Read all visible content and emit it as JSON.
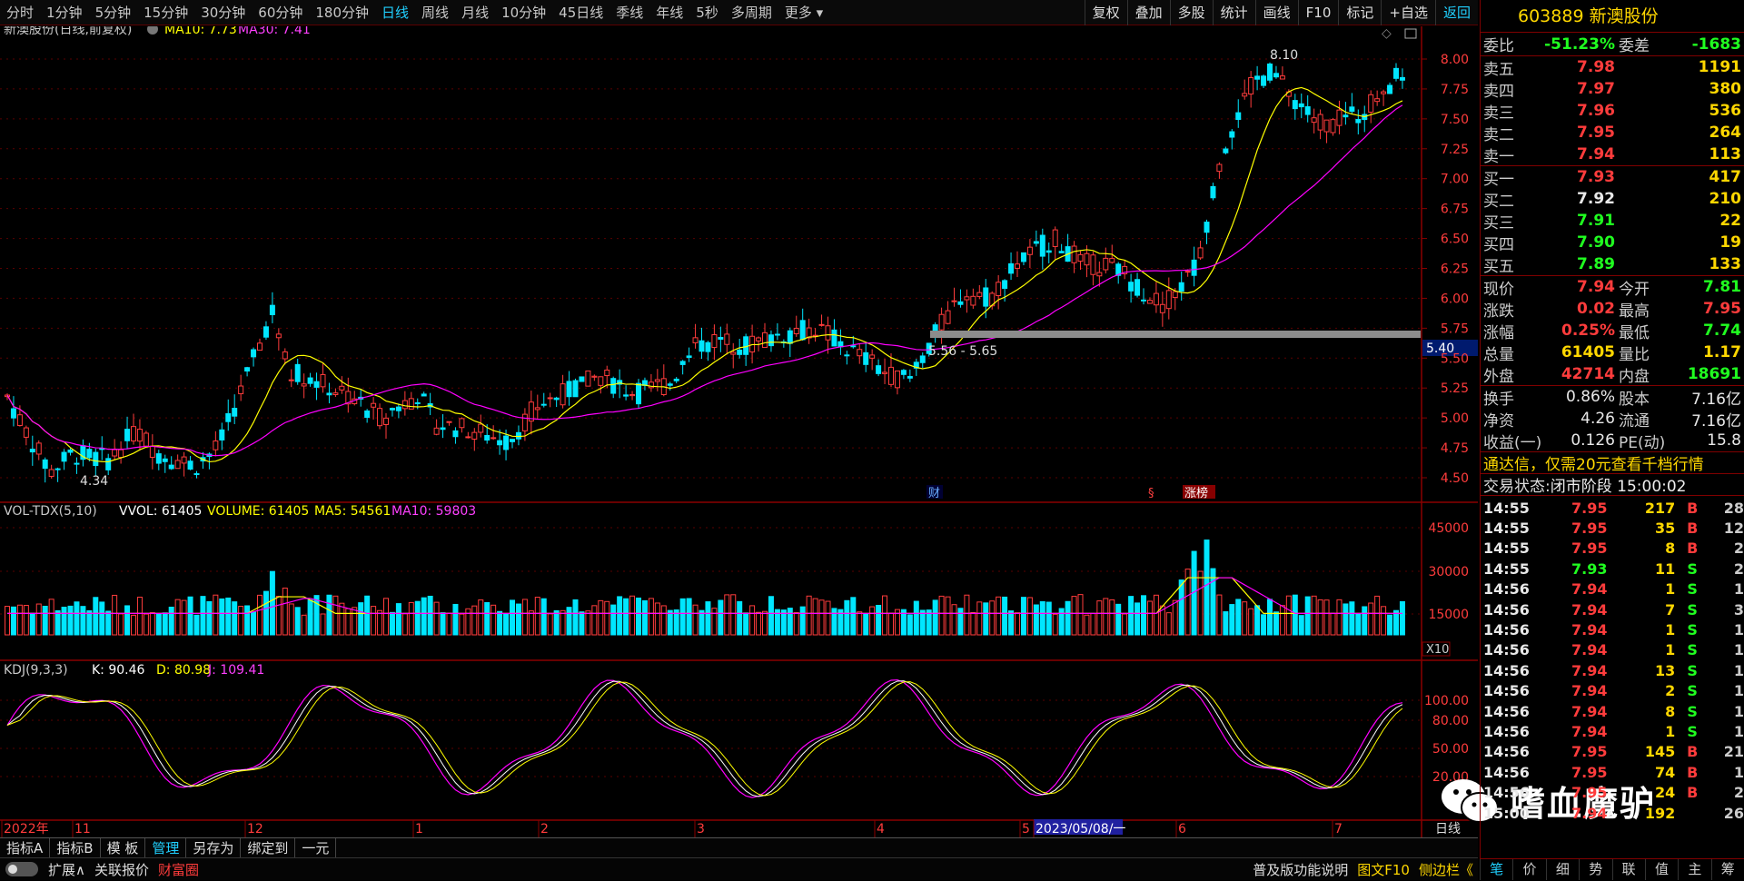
{
  "toolbar": {
    "periods": [
      "分时",
      "1分钟",
      "5分钟",
      "15分钟",
      "30分钟",
      "60分钟",
      "180分钟",
      "日线",
      "周线",
      "月线",
      "10分钟",
      "45日线",
      "季线",
      "年线",
      "5秒",
      "多周期",
      "更多"
    ],
    "active_period": "日线",
    "right_tools": [
      "复权",
      "叠加",
      "多股",
      "统计",
      "画线",
      "F10",
      "标记",
      "+自选",
      "返回"
    ]
  },
  "main_chart": {
    "title": "新澳股份(日线,前复权)",
    "ma10": "MA10: 7.73",
    "ma30": "MA30: 7.41",
    "high_label": "8.10",
    "low_label": "4.34",
    "range_label": "5.56 - 5.65",
    "price_tag": "5.40",
    "markers": [
      "财",
      "§",
      "涨榜"
    ],
    "y_ticks": [
      "8.00",
      "7.75",
      "7.50",
      "7.25",
      "7.00",
      "6.75",
      "6.50",
      "6.25",
      "6.00",
      "5.75",
      "5.50",
      "5.25",
      "5.00",
      "4.75",
      "4.50"
    ]
  },
  "volume_panel": {
    "label": "VOL-TDX(5,10)",
    "vvol": "VVOL: 61405",
    "volume": "VOLUME: 61405",
    "ma5": "MA5: 54561",
    "ma10": "MA10: 59803",
    "y_ticks": [
      "45000",
      "30000",
      "15000"
    ],
    "unit": "X10"
  },
  "kdj_panel": {
    "label": "KDJ(9,3,3)",
    "k": "K: 90.46",
    "d": "D: 80.98",
    "j": "J: 109.41",
    "y_ticks": [
      "100.00",
      "80.00",
      "50.00",
      "20.00"
    ]
  },
  "date_axis": {
    "labels": [
      "2022年",
      "11",
      "12",
      "1",
      "2",
      "3",
      "4",
      "5",
      "2023/05/08/一",
      "6",
      "7"
    ],
    "period_label": "日线"
  },
  "quote": {
    "code": "603889",
    "name": "新澳股份",
    "weibi_label": "委比",
    "weibi_value": "-51.23%",
    "weicha_label": "委差",
    "weicha_value": "-1683",
    "asks": [
      {
        "label": "卖五",
        "price": "7.98",
        "vol": "1191"
      },
      {
        "label": "卖四",
        "price": "7.97",
        "vol": "380"
      },
      {
        "label": "卖三",
        "price": "7.96",
        "vol": "536"
      },
      {
        "label": "卖二",
        "price": "7.95",
        "vol": "264"
      },
      {
        "label": "卖一",
        "price": "7.94",
        "vol": "113"
      }
    ],
    "bids": [
      {
        "label": "买一",
        "price": "7.93",
        "vol": "417"
      },
      {
        "label": "买二",
        "price": "7.92",
        "vol": "210"
      },
      {
        "label": "买三",
        "price": "7.91",
        "vol": "22"
      },
      {
        "label": "买四",
        "price": "7.90",
        "vol": "19"
      },
      {
        "label": "买五",
        "price": "7.89",
        "vol": "133"
      }
    ],
    "stats": [
      {
        "l1": "现价",
        "v1": "7.94",
        "l2": "今开",
        "v2": "7.81"
      },
      {
        "l1": "涨跌",
        "v1": "0.02",
        "l2": "最高",
        "v2": "7.95"
      },
      {
        "l1": "涨幅",
        "v1": "0.25%",
        "l2": "最低",
        "v2": "7.74"
      },
      {
        "l1": "总量",
        "v1": "61405",
        "l2": "量比",
        "v2": "1.17"
      },
      {
        "l1": "外盘",
        "v1": "42714",
        "l2": "内盘",
        "v2": "18691"
      }
    ],
    "stats2": [
      {
        "l1": "换手",
        "v1": "0.86%",
        "l2": "股本",
        "v2": "7.16亿"
      },
      {
        "l1": "净资",
        "v1": "4.26",
        "l2": "流通",
        "v2": "7.16亿"
      },
      {
        "l1": "收益(一)",
        "v1": "0.126",
        "l2": "PE(动)",
        "v2": "15.8"
      }
    ],
    "ad_text": "通达信，仅需20元查看千档行情",
    "status_label": "交易状态:",
    "status_value": "闭市阶段 15:00:02"
  },
  "trades": [
    {
      "t": "14:55",
      "p": "7.95",
      "v": "217",
      "s": "B",
      "n": "28"
    },
    {
      "t": "14:55",
      "p": "7.95",
      "v": "35",
      "s": "B",
      "n": "12"
    },
    {
      "t": "14:55",
      "p": "7.95",
      "v": "8",
      "s": "B",
      "n": "2"
    },
    {
      "t": "14:55",
      "p": "7.93",
      "v": "11",
      "s": "S",
      "n": "2"
    },
    {
      "t": "14:56",
      "p": "7.94",
      "v": "1",
      "s": "S",
      "n": "1"
    },
    {
      "t": "14:56",
      "p": "7.94",
      "v": "7",
      "s": "S",
      "n": "3"
    },
    {
      "t": "14:56",
      "p": "7.94",
      "v": "1",
      "s": "S",
      "n": "1"
    },
    {
      "t": "14:56",
      "p": "7.94",
      "v": "1",
      "s": "S",
      "n": "1"
    },
    {
      "t": "14:56",
      "p": "7.94",
      "v": "13",
      "s": "S",
      "n": "1"
    },
    {
      "t": "14:56",
      "p": "7.94",
      "v": "2",
      "s": "S",
      "n": "1"
    },
    {
      "t": "14:56",
      "p": "7.94",
      "v": "8",
      "s": "S",
      "n": "1"
    },
    {
      "t": "14:56",
      "p": "7.94",
      "v": "1",
      "s": "S",
      "n": "1"
    },
    {
      "t": "14:56",
      "p": "7.95",
      "v": "145",
      "s": "B",
      "n": "21"
    },
    {
      "t": "14:56",
      "p": "7.95",
      "v": "74",
      "s": "B",
      "n": "1"
    },
    {
      "t": "14:56",
      "p": "7.95",
      "v": "24",
      "s": "B",
      "n": "2"
    },
    {
      "t": "15:00",
      "p": "7.94",
      "v": "192",
      "s": "",
      "n": "26"
    }
  ],
  "right_tabs": [
    "笔",
    "价",
    "细",
    "势",
    "联",
    "值",
    "主",
    "筹"
  ],
  "bottom_bar1": [
    "指标A",
    "指标B",
    "模 板",
    "管理",
    "另存为",
    "绑定到",
    "一元"
  ],
  "bottom_bar2": [
    "扩展∧",
    "关联报价",
    "财富圈"
  ],
  "bottom_right": [
    "普及版功能说明",
    "图文F10",
    "侧边栏《"
  ],
  "watermark": "嗜血魔驴",
  "colors": {
    "up": "#ff3c3c",
    "down": "#00e6ff",
    "ma10": "#ffff00",
    "ma30": "#ff00ff",
    "grid": "#7a0000"
  }
}
